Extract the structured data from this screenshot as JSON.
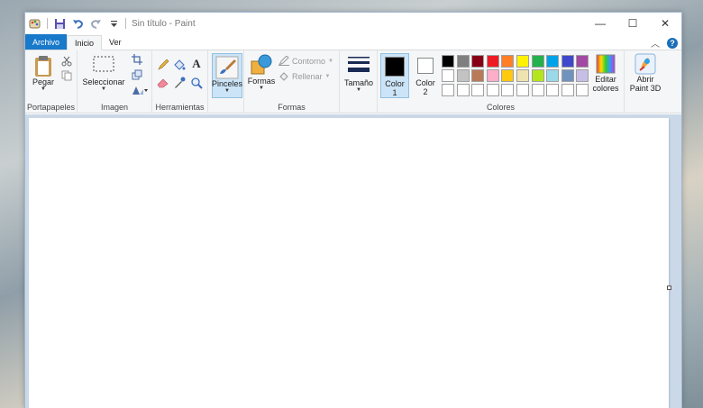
{
  "window": {
    "title": "Sin título - Paint",
    "controls": {
      "minimize": "—",
      "maximize": "☐",
      "close": "✕"
    }
  },
  "tabs": {
    "file": "Archivo",
    "home": "Inicio",
    "view": "Ver"
  },
  "groups": {
    "clipboard": "Portapapeles",
    "image": "Imagen",
    "tools": "Herramientas",
    "shapes": "Formas",
    "colors": "Colores"
  },
  "buttons": {
    "paste": "Pegar",
    "select": "Seleccionar",
    "brushes": "Pinceles",
    "shapes": "Formas",
    "outline": "Contorno",
    "fill": "Rellenar",
    "size": "Tamaño",
    "color1_line1": "Color",
    "color1_line2": "1",
    "color2_line1": "Color",
    "color2_line2": "2",
    "edit_colors_line1": "Editar",
    "edit_colors_line2": "colores",
    "paint3d_line1": "Abrir",
    "paint3d_line2": "Paint 3D"
  },
  "palette": {
    "row1": [
      "#000000",
      "#7f7f7f",
      "#880015",
      "#ed1c24",
      "#ff7f27",
      "#fff200",
      "#22b14c",
      "#00a2e8",
      "#3f48cc",
      "#a349a4"
    ],
    "row2": [
      "#ffffff",
      "#c3c3c3",
      "#b97a57",
      "#ffaec9",
      "#ffc90e",
      "#efe4b0",
      "#b5e61d",
      "#99d9ea",
      "#7092be",
      "#c8bfe7"
    ],
    "row3": [
      "#ffffff",
      "#ffffff",
      "#ffffff",
      "#ffffff",
      "#ffffff",
      "#ffffff",
      "#ffffff",
      "#ffffff",
      "#ffffff",
      "#ffffff"
    ]
  },
  "colors": {
    "color1": "#000000",
    "color2": "#ffffff",
    "file_tab": "#1979ca"
  }
}
